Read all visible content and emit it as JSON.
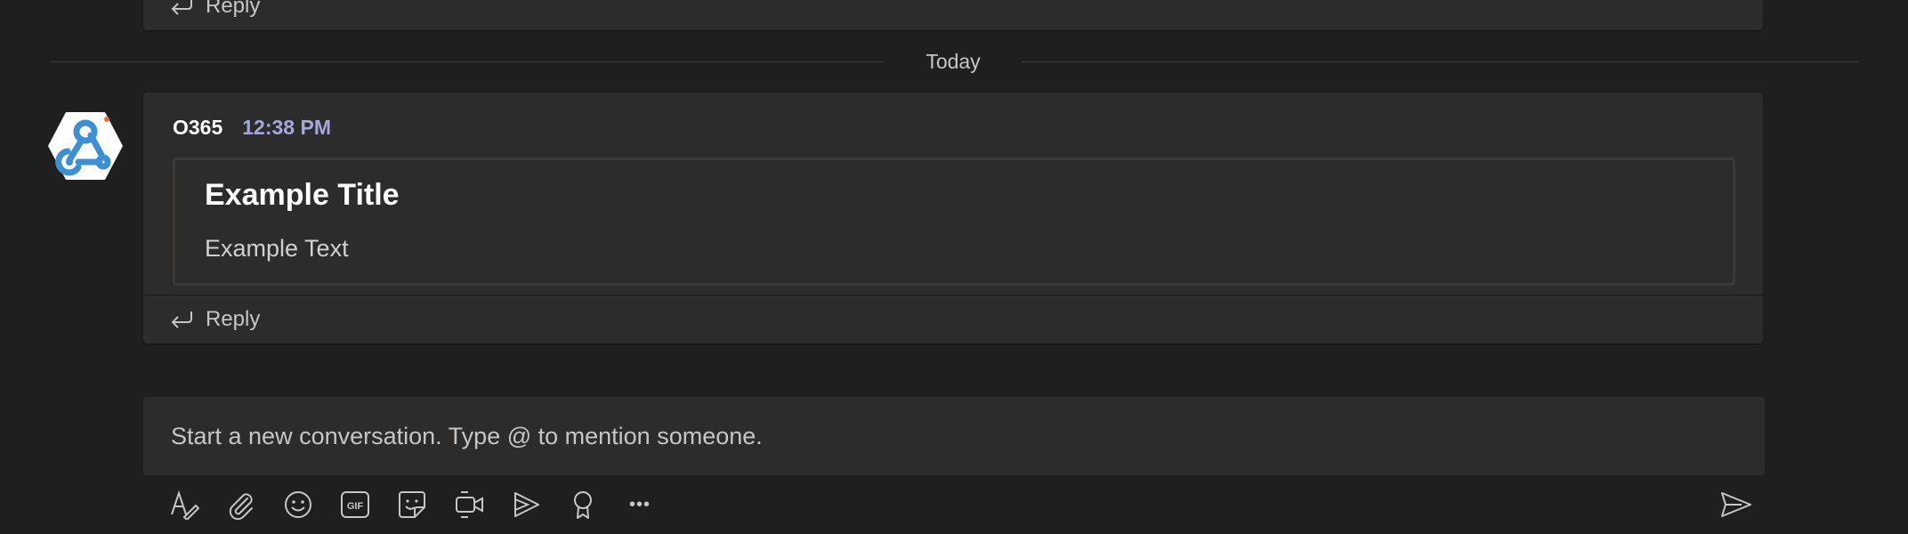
{
  "previous_message": {
    "reply_label": "Reply"
  },
  "date_divider": {
    "label": "Today"
  },
  "message": {
    "sender": "O365",
    "time": "12:38 PM",
    "card": {
      "title": "Example Title",
      "text": "Example Text"
    },
    "reply_label": "Reply"
  },
  "compose": {
    "placeholder": "Start a new conversation. Type @ to mention someone."
  },
  "toolbar": {
    "icons": [
      "format-icon",
      "attach-icon",
      "emoji-icon",
      "gif-icon",
      "sticker-icon",
      "meet-now-icon",
      "stream-icon",
      "praise-icon",
      "more-options-icon"
    ],
    "gif_label": "GIF",
    "more_label": "•••",
    "send_icon": "send-icon"
  },
  "colors": {
    "background": "#1f1f1f",
    "card": "#2d2c2c",
    "timestamp": "#a6a7dc",
    "avatar_blue": "#3b8fd3"
  }
}
